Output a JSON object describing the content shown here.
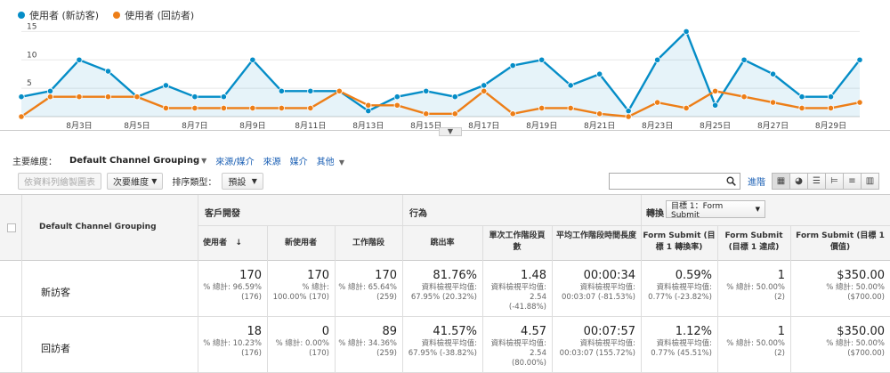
{
  "legend": [
    {
      "label": "使用者 (新訪客)",
      "color": "#058dc7"
    },
    {
      "label": "使用者 (回訪者)",
      "color": "#ed7e17"
    }
  ],
  "chart_data": {
    "type": "line",
    "x_labels": [
      "8月3日",
      "8月5日",
      "8月7日",
      "8月9日",
      "8月11日",
      "8月13日",
      "8月15日",
      "8月17日",
      "8月19日",
      "8月21日",
      "8月23日",
      "8月25日",
      "8月27日",
      "8月29日"
    ],
    "y_ticks": [
      5,
      10,
      15
    ],
    "ylim": [
      0,
      16
    ],
    "series": [
      {
        "name": "使用者 (新訪客)",
        "color": "#058dc7",
        "values": [
          3.5,
          4.5,
          10,
          8,
          3.5,
          5.5,
          3.5,
          3.5,
          10,
          4.5,
          4.5,
          4.5,
          1,
          3.5,
          4.5,
          3.5,
          5.5,
          9,
          10,
          5.5,
          7.5,
          1,
          10,
          15,
          2,
          10,
          7.5,
          3.5,
          3.5,
          10
        ]
      },
      {
        "name": "使用者 (回訪者)",
        "color": "#ed7e17",
        "values": [
          0,
          3.5,
          3.5,
          3.5,
          3.5,
          1.5,
          1.5,
          1.5,
          1.5,
          1.5,
          1.5,
          4.5,
          2,
          2,
          0.5,
          0.5,
          4.5,
          0.5,
          1.5,
          1.5,
          0.5,
          0,
          2.5,
          1.5,
          4.5,
          3.5,
          2.5,
          1.5,
          1.5,
          2.5
        ]
      }
    ]
  },
  "dimension_bar": {
    "primary_label": "主要維度：",
    "active": "Default Channel Grouping",
    "links": [
      "來源/媒介",
      "來源",
      "媒介",
      "其他"
    ]
  },
  "toolbar": {
    "plot_rows": "依資料列繪製圖表",
    "secondary_dim": "次要維度",
    "sort_label": "排序類型：",
    "sort_value": "預設",
    "advanced": "進階"
  },
  "table": {
    "dim_header": "Default Channel Grouping",
    "groups": {
      "acquisition": "客戶開發",
      "behavior": "行為",
      "conversion": "轉換"
    },
    "goal_select": "目標 1：Form Submit",
    "columns": [
      "使用者",
      "新使用者",
      "工作階段",
      "跳出率",
      "單次工作階段頁數",
      "平均工作階段時間長度",
      "Form Submit (目標 1 轉換率)",
      "Form Submit (目標 1 達成)",
      "Form Submit (目標 1 價值)"
    ],
    "rows": [
      {
        "name": "新訪客",
        "cells": [
          {
            "big": "170",
            "sub": [
              "% 總計: 96.59%",
              "(176)"
            ]
          },
          {
            "big": "170",
            "sub": [
              "% 總計:",
              "100.00% (170)"
            ]
          },
          {
            "big": "170",
            "sub": [
              "% 總計: 65.64%",
              "(259)"
            ]
          },
          {
            "big": "81.76%",
            "sub": [
              "資料檢視平均值:",
              "67.95% (20.32%)"
            ]
          },
          {
            "big": "1.48",
            "sub": [
              "資料檢視平均值: 2.54",
              "(-41.88%)"
            ]
          },
          {
            "big": "00:00:34",
            "sub": [
              "資料檢視平均值:",
              "00:03:07 (-81.53%)"
            ]
          },
          {
            "big": "0.59%",
            "sub": [
              "資料檢視平均值:",
              "0.77% (-23.82%)"
            ]
          },
          {
            "big": "1",
            "sub": [
              "% 總計: 50.00%",
              "(2)"
            ]
          },
          {
            "big": "$350.00",
            "sub": [
              "% 總計: 50.00%",
              "($700.00)"
            ]
          }
        ]
      },
      {
        "name": "回訪者",
        "cells": [
          {
            "big": "18",
            "sub": [
              "% 總計: 10.23%",
              "(176)"
            ]
          },
          {
            "big": "0",
            "sub": [
              "% 總計: 0.00%",
              "(170)"
            ]
          },
          {
            "big": "89",
            "sub": [
              "% 總計: 34.36%",
              "(259)"
            ]
          },
          {
            "big": "41.57%",
            "sub": [
              "資料檢視平均值:",
              "67.95% (-38.82%)"
            ]
          },
          {
            "big": "4.57",
            "sub": [
              "資料檢視平均值: 2.54",
              "(80.00%)"
            ]
          },
          {
            "big": "00:07:57",
            "sub": [
              "資料檢視平均值:",
              "00:03:07 (155.72%)"
            ]
          },
          {
            "big": "1.12%",
            "sub": [
              "資料檢視平均值:",
              "0.77% (45.51%)"
            ]
          },
          {
            "big": "1",
            "sub": [
              "% 總計: 50.00%",
              "(2)"
            ]
          },
          {
            "big": "$350.00",
            "sub": [
              "% 總計: 50.00%",
              "($700.00)"
            ]
          }
        ]
      }
    ]
  }
}
